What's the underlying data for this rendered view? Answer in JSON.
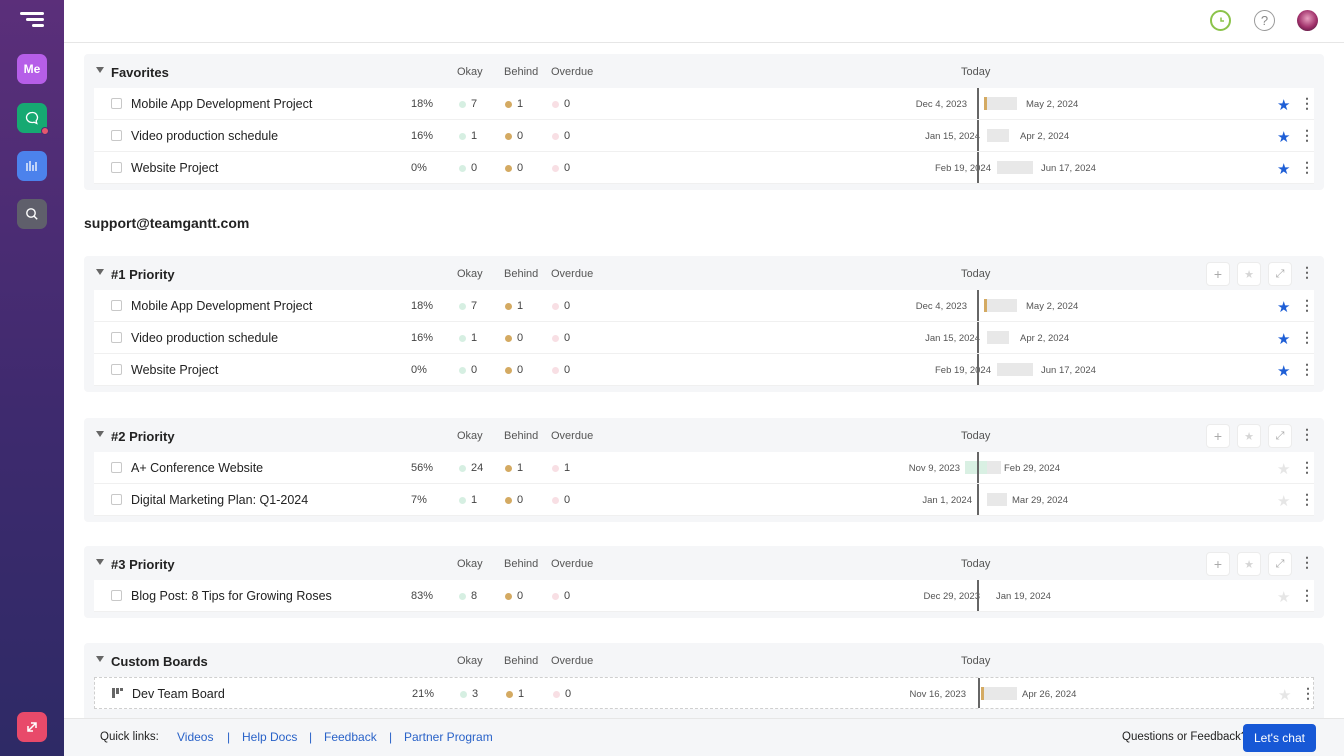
{
  "header": {
    "clock_icon": "clock-icon",
    "help_icon": "help-icon",
    "help_glyph": "?",
    "avatar": "avatar"
  },
  "nav": {
    "me_label": "Me",
    "items": [
      "logo-icon",
      "chat-icon",
      "reports-icon",
      "search-icon",
      "launch-icon"
    ]
  },
  "columns": {
    "okay": "Okay",
    "behind": "Behind",
    "overdue": "Overdue",
    "today": "Today"
  },
  "sections": [
    {
      "title": "Favorites",
      "projects": [
        {
          "name": "Mobile App Development Project",
          "pct": "18%",
          "okay": "7",
          "behind": "1",
          "overdue": "0",
          "start": "Dec 4, 2023",
          "end": "May 2, 2024",
          "starred": true
        },
        {
          "name": "Video production schedule",
          "pct": "16%",
          "okay": "1",
          "behind": "0",
          "overdue": "0",
          "start": "Jan 15, 2024",
          "end": "Apr 2, 2024",
          "starred": true
        },
        {
          "name": "Website Project",
          "pct": "0%",
          "okay": "0",
          "behind": "0",
          "overdue": "0",
          "start": "Feb 19, 2024",
          "end": "Jun 17, 2024",
          "starred": true
        }
      ]
    },
    {
      "title": "#1 Priority",
      "projects": [
        {
          "name": "Mobile App Development Project",
          "pct": "18%",
          "okay": "7",
          "behind": "1",
          "overdue": "0",
          "start": "Dec 4, 2023",
          "end": "May 2, 2024",
          "starred": true
        },
        {
          "name": "Video production schedule",
          "pct": "16%",
          "okay": "1",
          "behind": "0",
          "overdue": "0",
          "start": "Jan 15, 2024",
          "end": "Apr 2, 2024",
          "starred": true
        },
        {
          "name": "Website Project",
          "pct": "0%",
          "okay": "0",
          "behind": "0",
          "overdue": "0",
          "start": "Feb 19, 2024",
          "end": "Jun 17, 2024",
          "starred": true
        }
      ]
    },
    {
      "title": "#2 Priority",
      "projects": [
        {
          "name": "A+ Conference Website",
          "pct": "56%",
          "okay": "24",
          "behind": "1",
          "overdue": "1",
          "start": "Nov 9, 2023",
          "end": "Feb 29, 2024",
          "starred": false
        },
        {
          "name": "Digital Marketing Plan: Q1-2024",
          "pct": "7%",
          "okay": "1",
          "behind": "0",
          "overdue": "0",
          "start": "Jan 1, 2024",
          "end": "Mar 29, 2024",
          "starred": false
        }
      ]
    },
    {
      "title": "#3 Priority",
      "projects": [
        {
          "name": "Blog Post: 8 Tips for Growing Roses",
          "pct": "83%",
          "okay": "8",
          "behind": "0",
          "overdue": "0",
          "start": "Dec 29, 2023",
          "end": "Jan 19, 2024",
          "starred": false
        }
      ]
    },
    {
      "title": "Custom Boards",
      "projects": [
        {
          "name": "Dev Team Board",
          "pct": "21%",
          "okay": "3",
          "behind": "1",
          "overdue": "0",
          "start": "Nov 16, 2023",
          "end": "Apr 26, 2024",
          "starred": false
        }
      ]
    }
  ],
  "account_email": "support@teamgantt.com",
  "footer": {
    "quick_links_label": "Quick links:",
    "links": [
      "Videos",
      "Help Docs",
      "Feedback",
      "Partner Program"
    ],
    "separator": "|",
    "questions_label": "Questions or Feedback?",
    "chat_button": "Let's chat"
  },
  "colors": {
    "accent": "#1758d6",
    "star": "#1f5fd6",
    "behind": "#d4aa62",
    "okay": "#d6efe2",
    "overdue": "#f8dfe4"
  }
}
